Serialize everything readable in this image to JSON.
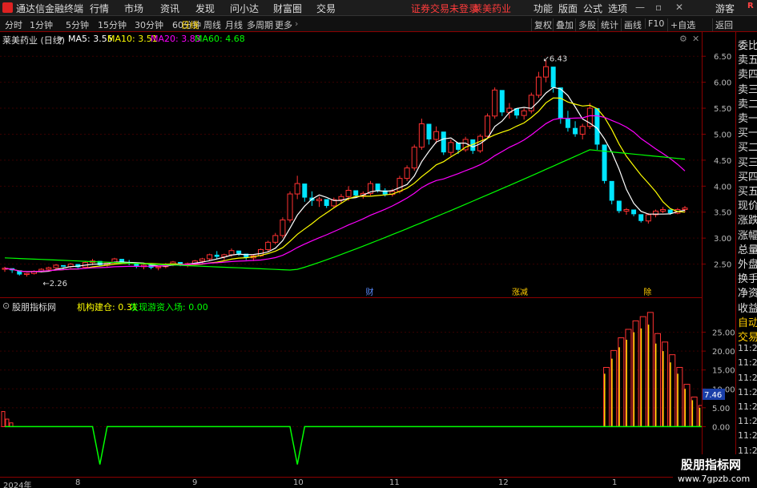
{
  "titlebar": {
    "app_name": "通达信金融终端",
    "menus": [
      "行情",
      "市场",
      "资讯",
      "发现",
      "问小达",
      "财富圈",
      "交易"
    ],
    "login_status": "证券交易未登录",
    "stock_name": "莱美药业",
    "right_menus": [
      "功能",
      "版面",
      "公式",
      "选项"
    ],
    "user": "游客",
    "r_badge": "R"
  },
  "toolbar": {
    "periods": [
      "分时",
      "1分钟",
      "5分钟",
      "15分钟",
      "30分钟",
      "60分钟",
      "日线",
      "周线",
      "月线",
      "多周期",
      "更多"
    ],
    "active_period": "日线",
    "buttons": [
      "复权",
      "叠加",
      "多股",
      "统计",
      "画线",
      "F10",
      "+自选",
      "返回"
    ]
  },
  "main_chart": {
    "title": "莱美药业 (日线)",
    "ma5_label": "MA5: 3.55",
    "ma10_label": "MA10: 3.51",
    "ma20_label": "MA20: 3.83",
    "ma60_label": "MA60: 4.68",
    "high_label": "6.43",
    "low_label": "2.26",
    "markers": [
      "财",
      "涨减",
      "除",
      "除"
    ]
  },
  "indicator": {
    "name": "股朋指标网",
    "jigou_label": "机构建仓: 0.31",
    "youzi_label": "发现游资入场: 0.00",
    "value_tag": "7.46"
  },
  "price_axis": [
    "6.50",
    "6.00",
    "5.50",
    "5.00",
    "4.50",
    "4.00",
    "3.50",
    "3.00",
    "2.50"
  ],
  "ind_axis": [
    "25.00",
    "20.00",
    "15.00",
    "10.00",
    "5.00",
    "0.00"
  ],
  "side_panel": [
    "委比",
    "卖五",
    "卖四",
    "卖三",
    "卖二",
    "卖一",
    "买一",
    "买二",
    "买三",
    "买四",
    "买五",
    "现价",
    "涨跌",
    "涨幅",
    "总量",
    "外盘",
    "换手",
    "净资",
    "收益",
    "自动",
    "交易",
    "11:27",
    "11:27",
    "11:27",
    "11:28",
    "11:28",
    "11:28",
    "11:28",
    "11:28",
    "11:28"
  ],
  "date_axis": [
    "2024年",
    "8",
    "9",
    "10",
    "11",
    "12",
    "1"
  ],
  "watermark": {
    "line1": "股朋指标网",
    "line2": "www.7gpzb.com"
  },
  "colors": {
    "up": "#ff3232",
    "down": "#00e5ff",
    "ma5": "#ffffff",
    "ma10": "#ffff00",
    "ma20": "#ff00ff",
    "ma60": "#00ff00",
    "panel_border": "#8b0000"
  },
  "chart_data": {
    "type": "candlestick",
    "price_range": [
      2.0,
      6.75
    ],
    "candles": [
      [
        2.4,
        2.45,
        2.35,
        2.42
      ],
      [
        2.42,
        2.4,
        2.33,
        2.38
      ],
      [
        2.38,
        2.32,
        2.28,
        2.3
      ],
      [
        2.3,
        2.33,
        2.26,
        2.32
      ],
      [
        2.32,
        2.38,
        2.3,
        2.36
      ],
      [
        2.36,
        2.42,
        2.34,
        2.4
      ],
      [
        2.4,
        2.45,
        2.37,
        2.43
      ],
      [
        2.43,
        2.5,
        2.4,
        2.48
      ],
      [
        2.48,
        2.44,
        2.4,
        2.45
      ],
      [
        2.45,
        2.52,
        2.42,
        2.5
      ],
      [
        2.5,
        2.46,
        2.42,
        2.44
      ],
      [
        2.44,
        2.55,
        2.42,
        2.53
      ],
      [
        2.53,
        2.6,
        2.48,
        2.56
      ],
      [
        2.56,
        2.5,
        2.46,
        2.48
      ],
      [
        2.48,
        2.54,
        2.44,
        2.52
      ],
      [
        2.52,
        2.62,
        2.5,
        2.6
      ],
      [
        2.6,
        2.56,
        2.5,
        2.54
      ],
      [
        2.54,
        2.58,
        2.48,
        2.52
      ],
      [
        2.52,
        2.48,
        2.42,
        2.45
      ],
      [
        2.45,
        2.5,
        2.4,
        2.48
      ],
      [
        2.48,
        2.46,
        2.4,
        2.43
      ],
      [
        2.43,
        2.47,
        2.38,
        2.45
      ],
      [
        2.45,
        2.52,
        2.42,
        2.5
      ],
      [
        2.5,
        2.56,
        2.46,
        2.54
      ],
      [
        2.54,
        2.5,
        2.46,
        2.48
      ],
      [
        2.48,
        2.53,
        2.44,
        2.51
      ],
      [
        2.51,
        2.58,
        2.49,
        2.56
      ],
      [
        2.56,
        2.62,
        2.52,
        2.6
      ],
      [
        2.6,
        2.7,
        2.56,
        2.68
      ],
      [
        2.68,
        2.75,
        2.6,
        2.64
      ],
      [
        2.64,
        2.7,
        2.58,
        2.68
      ],
      [
        2.68,
        2.8,
        2.64,
        2.76
      ],
      [
        2.76,
        2.72,
        2.66,
        2.7
      ],
      [
        2.7,
        2.66,
        2.58,
        2.62
      ],
      [
        2.62,
        2.68,
        2.56,
        2.66
      ],
      [
        2.66,
        2.8,
        2.64,
        2.78
      ],
      [
        2.78,
        2.95,
        2.74,
        2.92
      ],
      [
        2.92,
        3.1,
        2.88,
        3.05
      ],
      [
        3.05,
        3.4,
        3.0,
        3.35
      ],
      [
        3.35,
        3.9,
        3.3,
        3.85
      ],
      [
        3.85,
        4.2,
        3.75,
        4.05
      ],
      [
        4.05,
        3.95,
        3.7,
        3.78
      ],
      [
        3.78,
        3.9,
        3.62,
        3.72
      ],
      [
        3.72,
        3.8,
        3.6,
        3.75
      ],
      [
        3.75,
        3.7,
        3.58,
        3.62
      ],
      [
        3.62,
        3.78,
        3.58,
        3.74
      ],
      [
        3.74,
        3.85,
        3.66,
        3.8
      ],
      [
        3.8,
        4.0,
        3.72,
        3.92
      ],
      [
        3.92,
        3.88,
        3.78,
        3.82
      ],
      [
        3.82,
        3.9,
        3.76,
        3.86
      ],
      [
        3.86,
        4.1,
        3.82,
        4.05
      ],
      [
        4.05,
        3.98,
        3.88,
        3.92
      ],
      [
        3.92,
        3.96,
        3.8,
        3.84
      ],
      [
        3.84,
        3.95,
        3.8,
        3.9
      ],
      [
        3.9,
        4.2,
        3.86,
        4.15
      ],
      [
        4.15,
        4.4,
        4.1,
        4.35
      ],
      [
        4.35,
        4.8,
        4.3,
        4.75
      ],
      [
        4.75,
        5.3,
        4.7,
        5.2
      ],
      [
        5.2,
        5.05,
        4.8,
        4.9
      ],
      [
        4.9,
        5.15,
        4.82,
        5.05
      ],
      [
        5.05,
        4.8,
        4.6,
        4.65
      ],
      [
        4.65,
        4.9,
        4.58,
        4.84
      ],
      [
        4.84,
        4.75,
        4.62,
        4.7
      ],
      [
        4.7,
        4.95,
        4.66,
        4.9
      ],
      [
        4.9,
        4.76,
        4.62,
        4.68
      ],
      [
        4.68,
        5.0,
        4.64,
        4.96
      ],
      [
        4.96,
        5.4,
        4.92,
        5.35
      ],
      [
        5.35,
        5.9,
        5.3,
        5.85
      ],
      [
        5.85,
        5.55,
        5.35,
        5.42
      ],
      [
        5.42,
        5.6,
        5.3,
        5.5
      ],
      [
        5.5,
        5.42,
        5.3,
        5.36
      ],
      [
        5.36,
        5.5,
        5.28,
        5.45
      ],
      [
        5.45,
        5.8,
        5.4,
        5.75
      ],
      [
        5.75,
        6.2,
        5.7,
        6.1
      ],
      [
        6.1,
        6.43,
        6.0,
        6.3
      ],
      [
        6.3,
        6.0,
        5.8,
        5.9
      ],
      [
        5.9,
        5.4,
        5.2,
        5.3
      ],
      [
        5.3,
        5.45,
        5.05,
        5.12
      ],
      [
        5.12,
        5.25,
        4.95,
        5.0
      ],
      [
        5.0,
        5.2,
        4.9,
        5.15
      ],
      [
        5.15,
        5.6,
        5.1,
        5.5
      ],
      [
        5.5,
        5.1,
        4.7,
        4.8
      ],
      [
        4.8,
        4.3,
        4.05,
        4.1
      ],
      [
        4.1,
        3.85,
        3.65,
        3.72
      ],
      [
        3.72,
        3.6,
        3.48,
        3.52
      ],
      [
        3.52,
        3.58,
        3.45,
        3.55
      ],
      [
        3.55,
        3.5,
        3.42,
        3.46
      ],
      [
        3.46,
        3.4,
        3.3,
        3.33
      ],
      [
        3.33,
        3.48,
        3.28,
        3.45
      ],
      [
        3.45,
        3.55,
        3.4,
        3.52
      ],
      [
        3.52,
        3.6,
        3.48,
        3.55
      ],
      [
        3.55,
        3.5,
        3.45,
        3.48
      ],
      [
        3.48,
        3.58,
        3.46,
        3.55
      ],
      [
        3.55,
        3.62,
        3.5,
        3.58
      ]
    ],
    "ma5_end": 3.55,
    "ma10_end": 3.51,
    "ma20_end": 3.83,
    "ma60_end": 4.68,
    "indicator_range": [
      -12,
      30
    ],
    "jigou_bars": [
      0,
      0,
      0,
      0,
      0,
      0,
      0,
      0,
      0,
      0,
      0,
      0,
      0,
      0,
      0,
      0,
      0,
      0,
      0,
      0,
      0,
      0,
      0,
      0,
      0,
      0,
      0,
      0,
      0,
      0,
      0,
      0,
      0,
      0,
      0,
      0,
      0,
      0,
      0,
      0,
      0,
      0,
      0,
      0,
      0,
      0,
      0,
      0,
      0,
      0,
      0,
      0,
      0,
      0,
      0,
      0,
      0,
      0,
      0,
      0,
      0,
      0,
      0,
      0,
      0,
      0,
      0,
      0,
      0,
      0,
      0,
      0,
      0,
      0,
      0,
      0,
      0,
      0,
      0,
      0,
      0,
      0,
      14,
      18,
      21,
      23,
      25,
      26,
      27,
      22,
      20,
      17,
      14,
      10,
      7,
      5,
      3,
      2
    ],
    "youzi_line": [
      0,
      0,
      0,
      0,
      0,
      0,
      0,
      0,
      0,
      0,
      0,
      0,
      0,
      -10,
      0,
      0,
      0,
      0,
      0,
      0,
      0,
      0,
      0,
      0,
      0,
      0,
      0,
      0,
      0,
      0,
      0,
      0,
      0,
      0,
      0,
      0,
      0,
      0,
      0,
      0,
      -10,
      0,
      0,
      0,
      0,
      0,
      0,
      0,
      0,
      0,
      0,
      0,
      0,
      0,
      0,
      0,
      0,
      0,
      0,
      0,
      0,
      0,
      0,
      0,
      0,
      0,
      0,
      0,
      0,
      0,
      0,
      0,
      0,
      0,
      0,
      0,
      0,
      0,
      0,
      0,
      0,
      0,
      0,
      0,
      0,
      0,
      0,
      0,
      0,
      0,
      0,
      0,
      0,
      0,
      0,
      0,
      0,
      0
    ]
  }
}
